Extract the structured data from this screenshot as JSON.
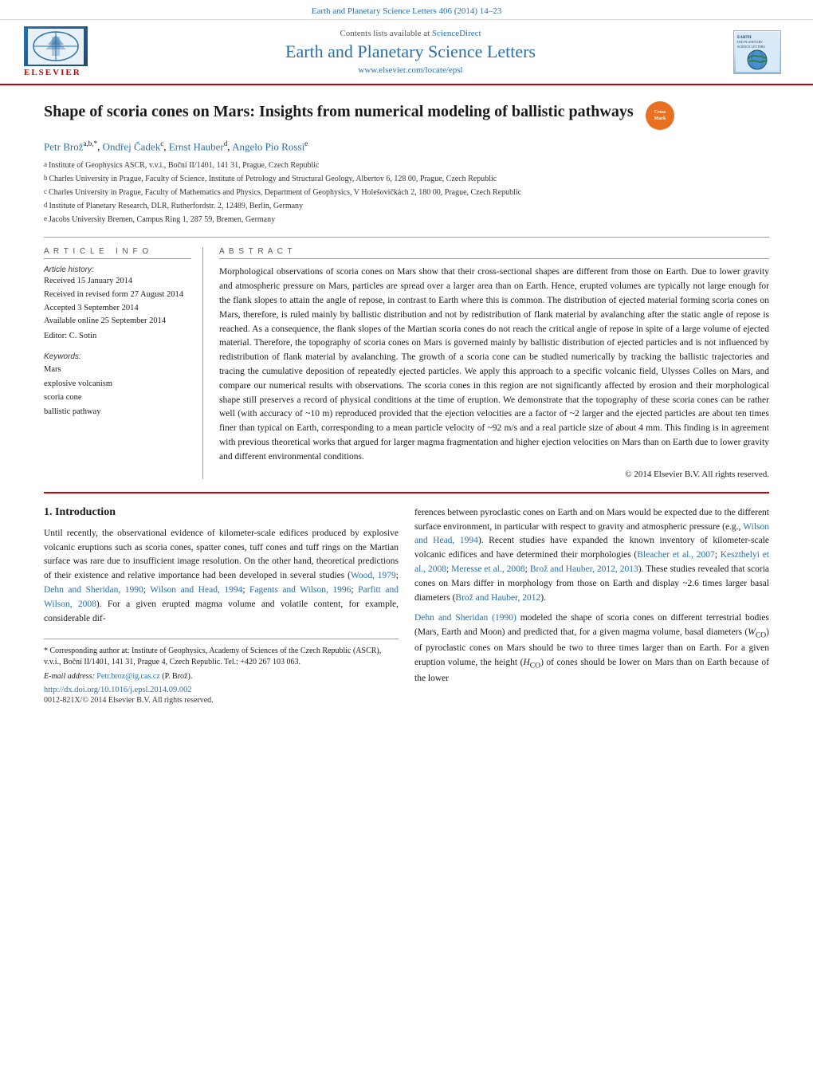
{
  "header": {
    "topbar_text": "Earth and Planetary Science Letters 406 (2014) 14–23",
    "contents_text": "Contents lists available at",
    "contents_link": "ScienceDirect",
    "journal_title": "Earth and Planetary Science Letters",
    "journal_url": "www.elsevier.com/locate/epsl",
    "elsevier_label": "ELSEVIER",
    "earth_logo_text": "EARTH AND PLANETARY SCIENCE LETTERS"
  },
  "article": {
    "title": "Shape of scoria cones on Mars: Insights from numerical modeling of ballistic pathways",
    "authors": "Petr Brož a,b,*, Ondřej Čadek c, Ernst Hauber d, Angelo Pio Rossi e",
    "author_superscripts": "a,b,* c d e",
    "affiliations": [
      {
        "sup": "a",
        "text": "Institute of Geophysics ASCR, v.v.i., Boční II/1401, 141 31, Prague, Czech Republic"
      },
      {
        "sup": "b",
        "text": "Charles University in Prague, Faculty of Science, Institute of Petrology and Structural Geology, Albertov 6, 128 00, Prague, Czech Republic"
      },
      {
        "sup": "c",
        "text": "Charles University in Prague, Faculty of Mathematics and Physics, Department of Geophysics, V Holešovičkách 2, 180 00, Prague, Czech Republic"
      },
      {
        "sup": "d",
        "text": "Institute of Planetary Research, DLR, Rutherfordstr. 2, 12489, Berlin, Germany"
      },
      {
        "sup": "e",
        "text": "Jacobs University Bremen, Campus Ring 1, 287 59, Bremen, Germany"
      }
    ],
    "article_info": {
      "section_label": "Article  Info",
      "history_label": "Article history:",
      "received": "Received 15 January 2014",
      "received_revised": "Received in revised form 27 August 2014",
      "accepted": "Accepted 3 September 2014",
      "available_online": "Available online 25 September 2014",
      "editor_label": "Editor: C. Sotin",
      "keywords_label": "Keywords:",
      "keywords": [
        "Mars",
        "explosive volcanism",
        "scoria cone",
        "ballistic pathway"
      ]
    },
    "abstract": {
      "section_label": "Abstract",
      "text": "Morphological observations of scoria cones on Mars show that their cross-sectional shapes are different from those on Earth. Due to lower gravity and atmospheric pressure on Mars, particles are spread over a larger area than on Earth. Hence, erupted volumes are typically not large enough for the flank slopes to attain the angle of repose, in contrast to Earth where this is common. The distribution of ejected material forming scoria cones on Mars, therefore, is ruled mainly by ballistic distribution and not by redistribution of flank material by avalanching after the static angle of repose is reached. As a consequence, the flank slopes of the Martian scoria cones do not reach the critical angle of repose in spite of a large volume of ejected material. Therefore, the topography of scoria cones on Mars is governed mainly by ballistic distribution of ejected particles and is not influenced by redistribution of flank material by avalanching. The growth of a scoria cone can be studied numerically by tracking the ballistic trajectories and tracing the cumulative deposition of repeatedly ejected particles. We apply this approach to a specific volcanic field, Ulysses Colles on Mars, and compare our numerical results with observations. The scoria cones in this region are not significantly affected by erosion and their morphological shape still preserves a record of physical conditions at the time of eruption. We demonstrate that the topography of these scoria cones can be rather well (with accuracy of ~10 m) reproduced provided that the ejection velocities are a factor of ~2 larger and the ejected particles are about ten times finer than typical on Earth, corresponding to a mean particle velocity of ~92 m/s and a real particle size of about 4 mm. This finding is in agreement with previous theoretical works that argued for larger magma fragmentation and higher ejection velocities on Mars than on Earth due to lower gravity and different environmental conditions.",
      "copyright": "© 2014 Elsevier B.V. All rights reserved."
    },
    "section1": {
      "number": "1.",
      "title": "Introduction",
      "left_col": "Until recently, the observational evidence of kilometer-scale edifices produced by explosive volcanic eruptions such as scoria cones, spatter cones, tuff cones and tuff rings on the Martian surface was rare due to insufficient image resolution. On the other hand, theoretical predictions of their existence and relative importance had been developed in several studies (Wood, 1979; Dehn and Sheridan, 1990; Wilson and Head, 1994; Fagents and Wilson, 1996; Parfitt and Wilson, 2008). For a given erupted magma volume and volatile content, for example, considerable dif-",
      "right_col": "ferences between pyroclastic cones on Earth and on Mars would be expected due to the different surface environment, in particular with respect to gravity and atmospheric pressure (e.g., Wilson and Head, 1994). Recent studies have expanded the known inventory of kilometer-scale volcanic edifices and have determined their morphologies (Bleacher et al., 2007; Keszthelyi et al., 2008; Meresse et al., 2008; Brož and Hauber, 2012, 2013). These studies revealed that scoria cones on Mars differ in morphology from those on Earth and display ~2.6 times larger basal diameters (Brož and Hauber, 2012).",
      "right_col2": "Dehn and Sheridan (1990) modeled the shape of scoria cones on different terrestrial bodies (Mars, Earth and Moon) and predicted that, for a given magma volume, basal diameters (W_CO) of pyroclastic cones on Mars should be two to three times larger than on Earth. For a given eruption volume, the height (H_CO) of cones should be lower on Mars than on Earth because of the lower"
    },
    "footnotes": {
      "corresponding_author": "* Corresponding author at: Institute of Geophysics, Academy of Sciences of the Czech Republic (ASCR), v.v.i., Boční II/1401, 141 31, Prague 4, Czech Republic. Tel.: +420 267 103 063.",
      "email": "E-mail address: Petr.broz@ig.cas.cz (P. Brož).",
      "doi": "http://dx.doi.org/10.1016/j.epsl.2014.09.002",
      "issn": "0012-821X/© 2014 Elsevier B.V. All rights reserved."
    }
  }
}
